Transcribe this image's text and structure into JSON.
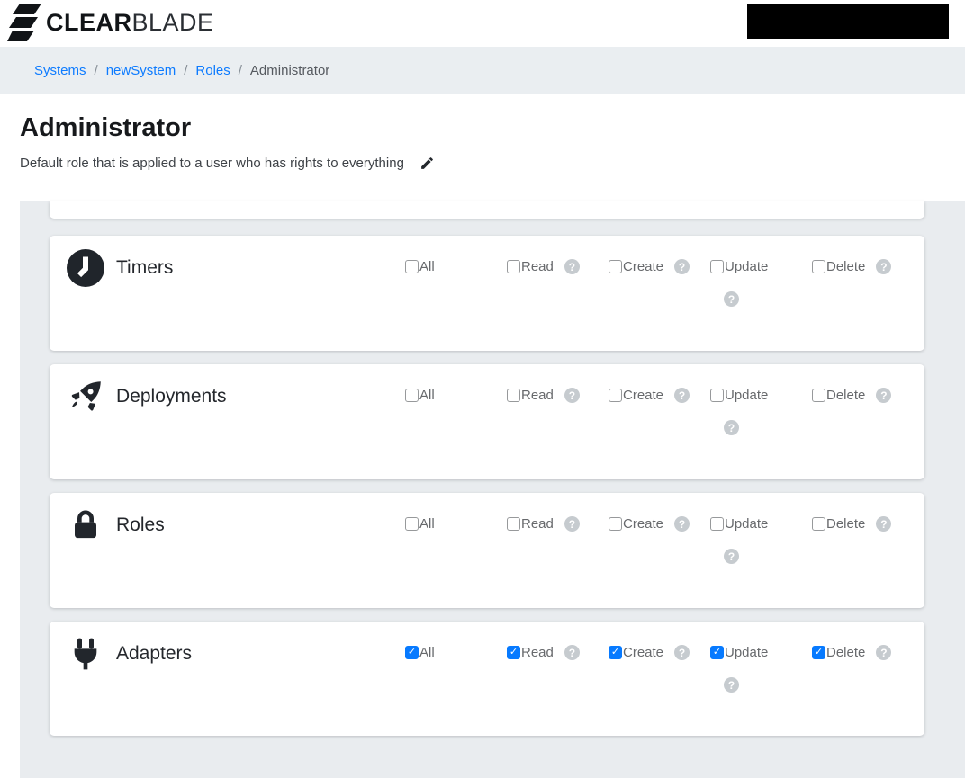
{
  "brand": {
    "name_bold": "CLEAR",
    "name_light": "BLADE"
  },
  "breadcrumb": {
    "separator": "/",
    "items": [
      {
        "label": "Systems",
        "link": true
      },
      {
        "label": "newSystem",
        "link": true
      },
      {
        "label": "Roles",
        "link": true
      },
      {
        "label": "Administrator",
        "link": false
      }
    ]
  },
  "page": {
    "title": "Administrator",
    "subtitle": "Default role that is applied to a user who has rights to everything"
  },
  "permissions": {
    "columns": [
      "All",
      "Read",
      "Create",
      "Update",
      "Delete"
    ],
    "sections": [
      {
        "name": "Timers",
        "icon": "clock-icon",
        "checks": {
          "all": false,
          "read": false,
          "create": false,
          "update": false,
          "delete": false
        }
      },
      {
        "name": "Deployments",
        "icon": "rocket-icon",
        "checks": {
          "all": false,
          "read": false,
          "create": false,
          "update": false,
          "delete": false
        }
      },
      {
        "name": "Roles",
        "icon": "lock-icon",
        "checks": {
          "all": false,
          "read": false,
          "create": false,
          "update": false,
          "delete": false
        }
      },
      {
        "name": "Adapters",
        "icon": "plug-icon",
        "checks": {
          "all": true,
          "read": true,
          "create": true,
          "update": true,
          "delete": true
        }
      }
    ]
  },
  "colors": {
    "link_blue": "#0d7bff",
    "checked_blue": "#077aff",
    "help_gray": "#c6cbcf",
    "panel_bg": "#e9ecef",
    "icon_dark": "#22262c"
  }
}
